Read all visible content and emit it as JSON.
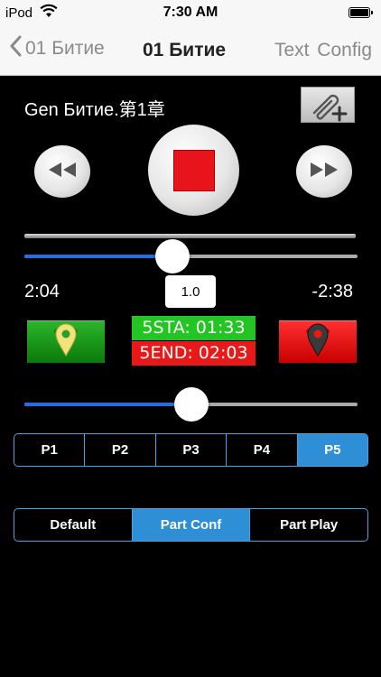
{
  "status": {
    "carrier": "iPod",
    "time": "7:30 AM"
  },
  "nav": {
    "back_label": "01 Битие",
    "title": "01 Битие",
    "text_btn": "Text",
    "config_btn": "Config"
  },
  "doc": {
    "title": "Gen Битие.第1章"
  },
  "player": {
    "elapsed": "2:04",
    "remaining": "-2:38",
    "speed": "1.0",
    "position_fraction": 0.44,
    "loop_position_fraction": 0.5,
    "start_tag": "5STA: 01:33",
    "end_tag": "5END: 02:03"
  },
  "parts": {
    "items": [
      {
        "label": "P1"
      },
      {
        "label": "P2"
      },
      {
        "label": "P3"
      },
      {
        "label": "P4"
      },
      {
        "label": "P5"
      }
    ],
    "selected": "P5"
  },
  "modes": {
    "items": [
      {
        "label": "Default"
      },
      {
        "label": "Part Conf"
      },
      {
        "label": "Part Play"
      }
    ],
    "selected": "Part Conf"
  },
  "colors": {
    "accent": "#2f8fd6",
    "start_green": "#22c522",
    "end_red": "#ea1919"
  },
  "icons": [
    "wifi-icon",
    "battery-icon",
    "back-chevron-icon",
    "paperclip-plus-icon",
    "rewind-icon",
    "stop-icon",
    "fast-forward-icon",
    "map-pin-icon"
  ]
}
